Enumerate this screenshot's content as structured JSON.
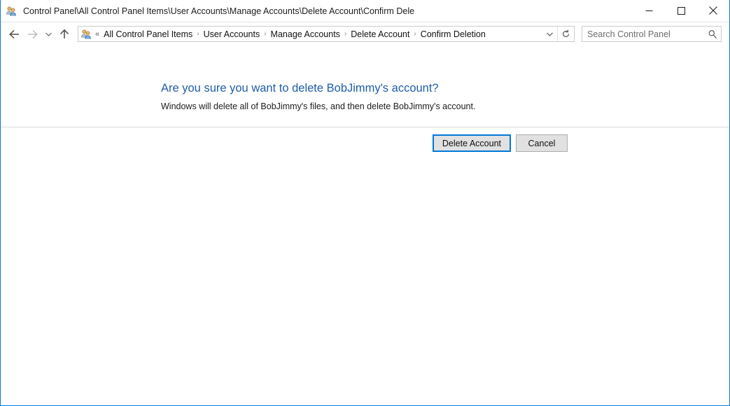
{
  "window": {
    "title": "Control Panel\\All Control Panel Items\\User Accounts\\Manage Accounts\\Delete Account\\Confirm Dele",
    "icon": "user-accounts-icon",
    "border_color": "#0b7ad1",
    "caption": {
      "minimize_label": "Minimize",
      "maximize_label": "Maximize",
      "close_label": "Close"
    }
  },
  "toolbar": {
    "back_label": "Back",
    "forward_label": "Forward",
    "recent_label": "Recent locations",
    "up_label": "Up one level",
    "address": {
      "icon": "user-accounts-icon",
      "overflow_indicator": "«",
      "crumbs": [
        {
          "label": "All Control Panel Items"
        },
        {
          "label": "User Accounts"
        },
        {
          "label": "Manage Accounts"
        },
        {
          "label": "Delete Account"
        },
        {
          "label": "Confirm Deletion"
        }
      ],
      "separator": "›",
      "dropdown_label": "Previous locations",
      "refresh_label": "Refresh"
    },
    "search": {
      "placeholder": "Search Control Panel",
      "value": "",
      "icon": "search-icon"
    }
  },
  "main": {
    "heading": "Are you sure you want to delete BobJimmy's account?",
    "heading_color": "#1f5da8",
    "description": "Windows will delete all of BobJimmy's files, and then delete BobJimmy's account.",
    "buttons": {
      "primary_label": "Delete Account",
      "primary_accent": "#0078d7",
      "secondary_label": "Cancel"
    }
  }
}
